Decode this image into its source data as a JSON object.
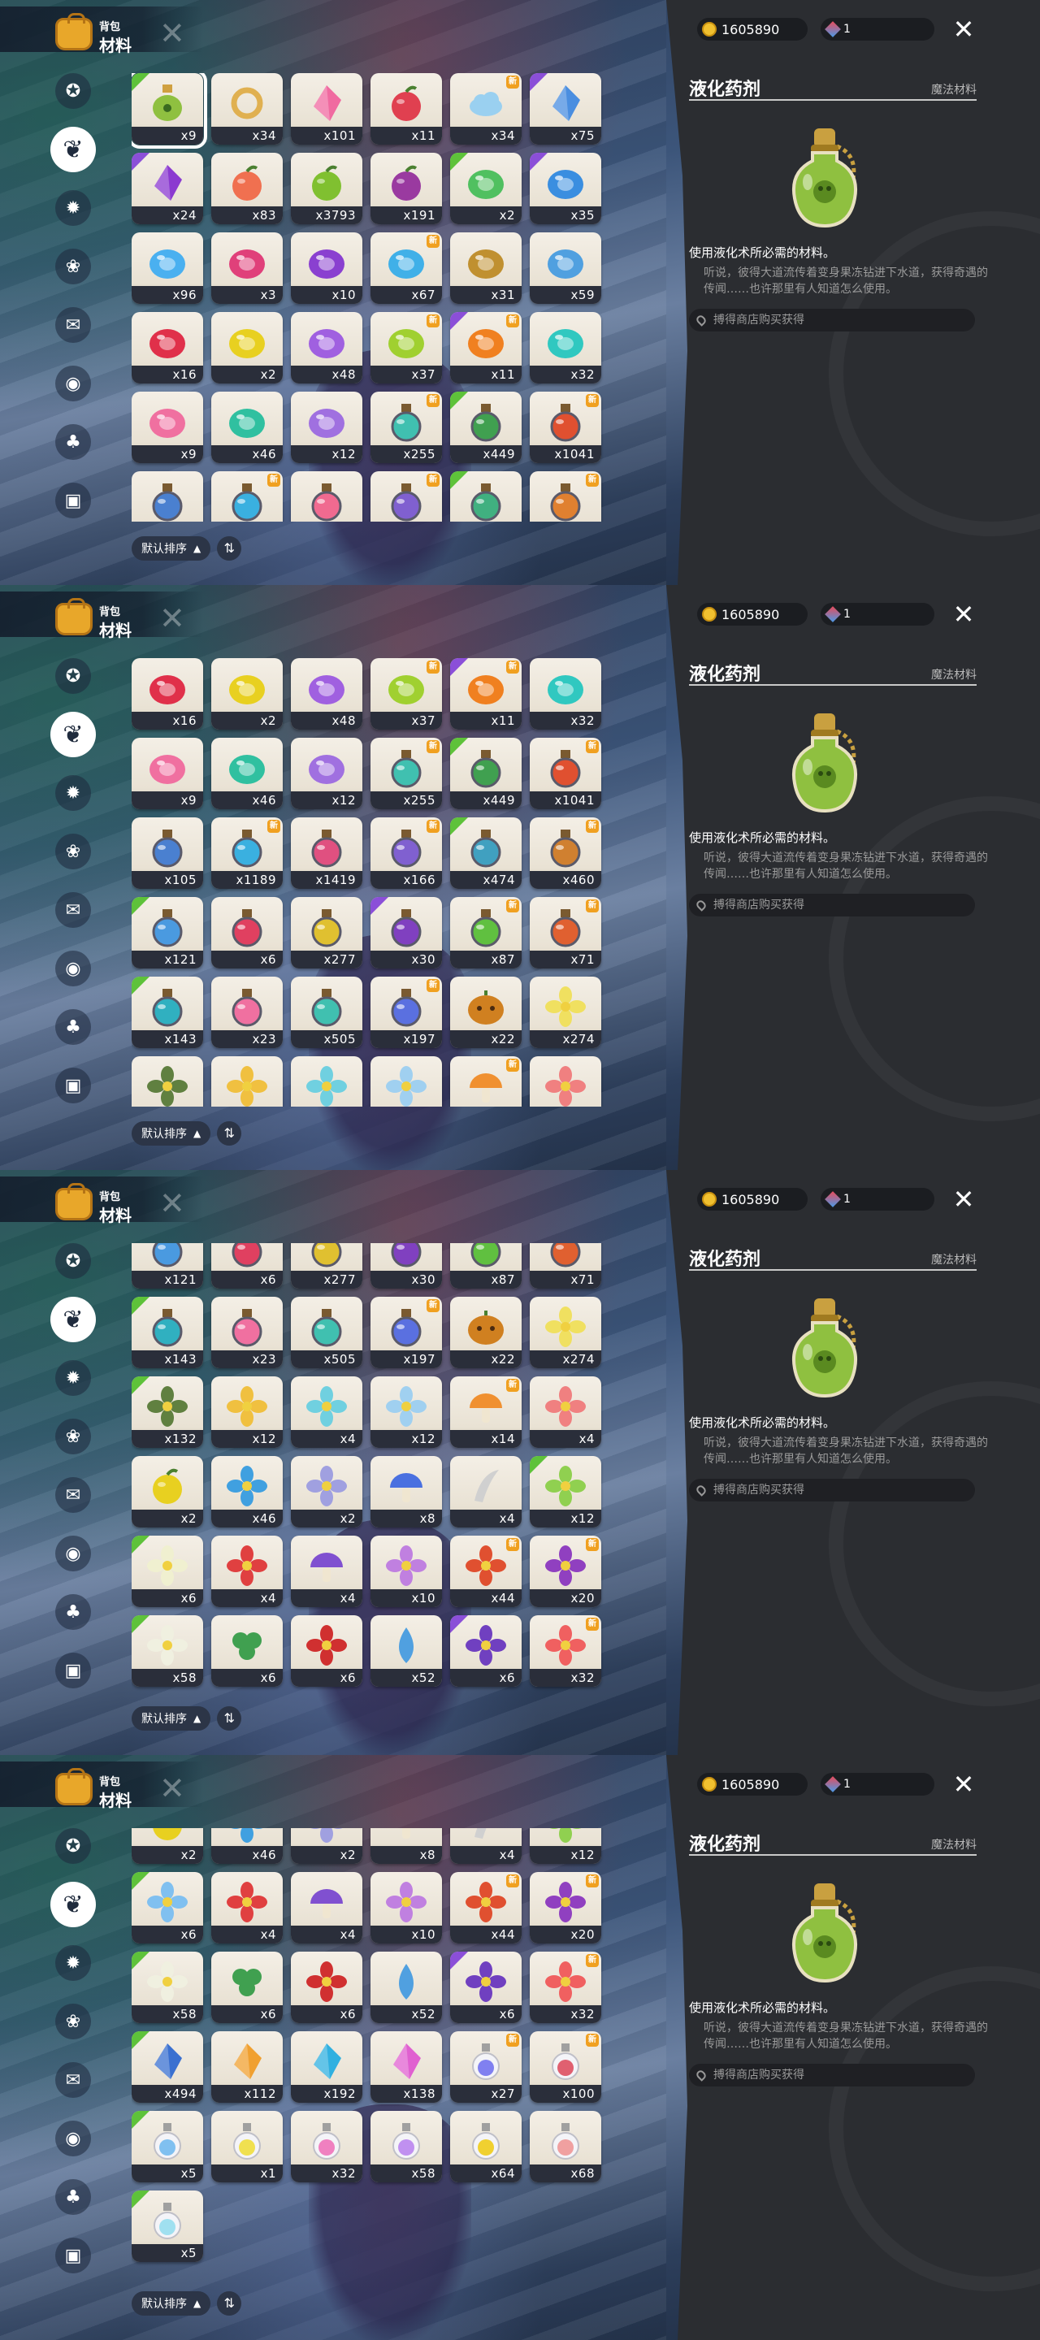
{
  "header": {
    "bag_label": "背包",
    "category_label": "材料"
  },
  "currency": {
    "coins": "1605890",
    "gems": "1"
  },
  "detail": {
    "title": "液化药剂",
    "type": "魔法材料",
    "summary": "使用液化术所必需的材料。",
    "description": "听说，彼得大道流传着变身果冻钻进下水道，获得奇遇的传闻……也许那里有人知道怎么使用。",
    "source": "搏得商店购买获得"
  },
  "sort": {
    "label": "默认排序"
  },
  "sidebar": {
    "icons": [
      "star-icon",
      "leaf-icon",
      "gear-icon",
      "petal-icon",
      "scroll-icon",
      "ball-icon",
      "bell-icon",
      "chest-icon"
    ],
    "selected": 1
  },
  "screens": [
    {
      "offset": 0,
      "rows": [
        [
          {
            "q": "x9",
            "c": "#8fc040",
            "s": "flask",
            "b": "green",
            "sel": true
          },
          {
            "q": "x34",
            "c": "#e0b050",
            "s": "ring"
          },
          {
            "q": "x101",
            "c": "#f06aa0",
            "s": "crystal"
          },
          {
            "q": "x11",
            "c": "#e04050",
            "s": "fruit"
          },
          {
            "q": "x34",
            "c": "#9ad0f0",
            "s": "cloud",
            "n": true
          },
          {
            "q": "x75",
            "c": "#4a8ee0",
            "s": "crystal",
            "b": "purple"
          }
        ],
        [
          {
            "q": "x24",
            "c": "#8b3ad0",
            "s": "crystal",
            "b": "purple"
          },
          {
            "q": "x83",
            "c": "#f07050",
            "s": "fruit"
          },
          {
            "q": "x3793",
            "c": "#80c030",
            "s": "fruit"
          },
          {
            "q": "x191",
            "c": "#9a3aa0",
            "s": "fruit"
          },
          {
            "q": "x2",
            "c": "#50c060",
            "s": "gem",
            "b": "green"
          },
          {
            "q": "x35",
            "c": "#3a8ee0",
            "s": "gem",
            "b": "purple"
          }
        ],
        [
          {
            "q": "x96",
            "c": "#4ab0f0",
            "s": "gem"
          },
          {
            "q": "x3",
            "c": "#e0407a",
            "s": "gem"
          },
          {
            "q": "x10",
            "c": "#8a40d0",
            "s": "gem"
          },
          {
            "q": "x67",
            "c": "#40b0e8",
            "s": "gem",
            "n": true
          },
          {
            "q": "x31",
            "c": "#c09030",
            "s": "gem"
          },
          {
            "q": "x59",
            "c": "#50a0e0",
            "s": "gem"
          }
        ],
        [
          {
            "q": "x16",
            "c": "#e0304a",
            "s": "gem"
          },
          {
            "q": "x2",
            "c": "#e8d020",
            "s": "gem"
          },
          {
            "q": "x48",
            "c": "#a060e0",
            "s": "gem"
          },
          {
            "q": "x37",
            "c": "#a0d030",
            "s": "gem",
            "n": true
          },
          {
            "q": "x11",
            "c": "#f08020",
            "s": "gem",
            "b": "purple",
            "n": true
          },
          {
            "q": "x32",
            "c": "#30c8c0",
            "s": "gem"
          }
        ],
        [
          {
            "q": "x9",
            "c": "#f070a0",
            "s": "gem"
          },
          {
            "q": "x46",
            "c": "#30c0a0",
            "s": "gem"
          },
          {
            "q": "x12",
            "c": "#a070e0",
            "s": "gem"
          },
          {
            "q": "x255",
            "c": "#40c0b0",
            "s": "potion",
            "n": true
          },
          {
            "q": "x449",
            "c": "#40a050",
            "s": "potion",
            "b": "green"
          },
          {
            "q": "x1041",
            "c": "#e05030",
            "s": "potion",
            "n": true
          }
        ],
        [
          {
            "q": "",
            "c": "#4a80d0",
            "s": "potion"
          },
          {
            "q": "",
            "c": "#3ab0e0",
            "s": "potion",
            "n": true
          },
          {
            "q": "",
            "c": "#f06a90",
            "s": "potion"
          },
          {
            "q": "",
            "c": "#8060d0",
            "s": "potion",
            "n": true
          },
          {
            "q": "",
            "c": "#40b080",
            "s": "potion",
            "b": "green"
          },
          {
            "q": "",
            "c": "#e08030",
            "s": "potion",
            "n": true
          }
        ]
      ]
    },
    {
      "offset": 0,
      "rows": [
        [
          {
            "q": "x16",
            "c": "#e0304a",
            "s": "gem"
          },
          {
            "q": "x2",
            "c": "#e8d020",
            "s": "gem"
          },
          {
            "q": "x48",
            "c": "#a060e0",
            "s": "gem"
          },
          {
            "q": "x37",
            "c": "#a0d030",
            "s": "gem",
            "n": true
          },
          {
            "q": "x11",
            "c": "#f08020",
            "s": "gem",
            "b": "purple",
            "n": true
          },
          {
            "q": "x32",
            "c": "#30c8c0",
            "s": "gem"
          }
        ],
        [
          {
            "q": "x9",
            "c": "#f070a0",
            "s": "gem"
          },
          {
            "q": "x46",
            "c": "#30c0a0",
            "s": "gem"
          },
          {
            "q": "x12",
            "c": "#a070e0",
            "s": "gem"
          },
          {
            "q": "x255",
            "c": "#40c0b0",
            "s": "potion",
            "n": true
          },
          {
            "q": "x449",
            "c": "#40a050",
            "s": "potion",
            "b": "green"
          },
          {
            "q": "x1041",
            "c": "#e05030",
            "s": "potion",
            "n": true
          }
        ],
        [
          {
            "q": "x105",
            "c": "#4a80d0",
            "s": "potion"
          },
          {
            "q": "x1189",
            "c": "#3ab0e0",
            "s": "potion",
            "n": true
          },
          {
            "q": "x1419",
            "c": "#e05080",
            "s": "potion"
          },
          {
            "q": "x166",
            "c": "#8060d0",
            "s": "potion",
            "n": true
          },
          {
            "q": "x474",
            "c": "#40a0c0",
            "s": "potion",
            "b": "green"
          },
          {
            "q": "x460",
            "c": "#d08030",
            "s": "potion",
            "n": true
          }
        ],
        [
          {
            "q": "x121",
            "c": "#4a9ae0",
            "s": "potion",
            "b": "green"
          },
          {
            "q": "x6",
            "c": "#e04060",
            "s": "potion"
          },
          {
            "q": "x277",
            "c": "#e0c030",
            "s": "potion"
          },
          {
            "q": "x30",
            "c": "#8040c0",
            "s": "potion",
            "b": "purple"
          },
          {
            "q": "x87",
            "c": "#60c040",
            "s": "potion",
            "n": true
          },
          {
            "q": "x71",
            "c": "#e06030",
            "s": "potion",
            "n": true
          }
        ],
        [
          {
            "q": "x143",
            "c": "#30b0c0",
            "s": "potion",
            "b": "green"
          },
          {
            "q": "x23",
            "c": "#f070a0",
            "s": "potion"
          },
          {
            "q": "x505",
            "c": "#40c0b0",
            "s": "potion"
          },
          {
            "q": "x197",
            "c": "#5a70e0",
            "s": "potion",
            "n": true
          },
          {
            "q": "x22",
            "c": "#d08020",
            "s": "pumpkin"
          },
          {
            "q": "x274",
            "c": "#f0e060",
            "s": "flower"
          }
        ],
        [
          {
            "q": "",
            "c": "#608040",
            "s": "flower"
          },
          {
            "q": "",
            "c": "#f0c040",
            "s": "flower"
          },
          {
            "q": "",
            "c": "#70d0e0",
            "s": "flower"
          },
          {
            "q": "",
            "c": "#a0d0f0",
            "s": "flower"
          },
          {
            "q": "",
            "c": "#f09030",
            "s": "mushroom",
            "n": true
          },
          {
            "q": "",
            "c": "#f08080",
            "s": "flower"
          }
        ]
      ]
    },
    {
      "offset": -32,
      "rows": [
        [
          {
            "q": "x121",
            "c": "#4a9ae0",
            "s": "potion",
            "b": "green"
          },
          {
            "q": "x6",
            "c": "#e04060",
            "s": "potion"
          },
          {
            "q": "x277",
            "c": "#e0c030",
            "s": "potion"
          },
          {
            "q": "x30",
            "c": "#8040c0",
            "s": "potion",
            "b": "purple"
          },
          {
            "q": "x87",
            "c": "#60c040",
            "s": "potion",
            "n": true
          },
          {
            "q": "x71",
            "c": "#e06030",
            "s": "potion",
            "n": true
          }
        ],
        [
          {
            "q": "x143",
            "c": "#30b0c0",
            "s": "potion",
            "b": "green"
          },
          {
            "q": "x23",
            "c": "#f070a0",
            "s": "potion"
          },
          {
            "q": "x505",
            "c": "#40c0b0",
            "s": "potion"
          },
          {
            "q": "x197",
            "c": "#5a70e0",
            "s": "potion",
            "n": true
          },
          {
            "q": "x22",
            "c": "#d08020",
            "s": "pumpkin"
          },
          {
            "q": "x274",
            "c": "#f0e060",
            "s": "flower"
          }
        ],
        [
          {
            "q": "x132",
            "c": "#608040",
            "s": "flower",
            "b": "green"
          },
          {
            "q": "x12",
            "c": "#f0c040",
            "s": "flower"
          },
          {
            "q": "x4",
            "c": "#70d0e0",
            "s": "flower"
          },
          {
            "q": "x12",
            "c": "#a0d0f0",
            "s": "flower"
          },
          {
            "q": "x14",
            "c": "#f09030",
            "s": "mushroom",
            "n": true
          },
          {
            "q": "x4",
            "c": "#f08080",
            "s": "flower"
          }
        ],
        [
          {
            "q": "x2",
            "c": "#e8d020",
            "s": "fruit"
          },
          {
            "q": "x46",
            "c": "#40a0e0",
            "s": "flower"
          },
          {
            "q": "x2",
            "c": "#a0a0e0",
            "s": "flower"
          },
          {
            "q": "x8",
            "c": "#4a70e0",
            "s": "mushroom"
          },
          {
            "q": "x4",
            "c": "#d0d0d0",
            "s": "horn"
          },
          {
            "q": "x12",
            "c": "#90d050",
            "s": "flower",
            "b": "green"
          }
        ],
        [
          {
            "q": "x6",
            "c": "#f0f0d0",
            "s": "flower",
            "b": "green"
          },
          {
            "q": "x4",
            "c": "#e04040",
            "s": "flower"
          },
          {
            "q": "x4",
            "c": "#8050d0",
            "s": "mushroom"
          },
          {
            "q": "x10",
            "c": "#c080e0",
            "s": "flower"
          },
          {
            "q": "x44",
            "c": "#e05030",
            "s": "flower",
            "n": true
          },
          {
            "q": "x20",
            "c": "#9040c0",
            "s": "flower",
            "n": true
          }
        ],
        [
          {
            "q": "x58",
            "c": "#f0f0e0",
            "s": "flower",
            "b": "green"
          },
          {
            "q": "x6",
            "c": "#40a050",
            "s": "leaf"
          },
          {
            "q": "x6",
            "c": "#d03030",
            "s": "flower"
          },
          {
            "q": "x52",
            "c": "#50a0e0",
            "s": "drop"
          },
          {
            "q": "x6",
            "c": "#7040c0",
            "s": "flower",
            "b": "purple"
          },
          {
            "q": "x32",
            "c": "#f06060",
            "s": "flower",
            "n": true
          }
        ]
      ]
    },
    {
      "offset": -44,
      "rows": [
        [
          {
            "q": "x2",
            "c": "#e8d020",
            "s": "fruit"
          },
          {
            "q": "x46",
            "c": "#40a0e0",
            "s": "flower"
          },
          {
            "q": "x2",
            "c": "#a0a0e0",
            "s": "flower"
          },
          {
            "q": "x8",
            "c": "#4a70e0",
            "s": "mushroom"
          },
          {
            "q": "x4",
            "c": "#d0d0d0",
            "s": "horn"
          },
          {
            "q": "x12",
            "c": "#90d050",
            "s": "flower",
            "b": "green"
          }
        ],
        [
          {
            "q": "x6",
            "c": "#80c0f0",
            "s": "flower",
            "b": "green"
          },
          {
            "q": "x4",
            "c": "#e04040",
            "s": "flower"
          },
          {
            "q": "x4",
            "c": "#8050d0",
            "s": "mushroom"
          },
          {
            "q": "x10",
            "c": "#c080e0",
            "s": "flower"
          },
          {
            "q": "x44",
            "c": "#e05030",
            "s": "flower",
            "n": true
          },
          {
            "q": "x20",
            "c": "#9040c0",
            "s": "flower",
            "n": true
          }
        ],
        [
          {
            "q": "x58",
            "c": "#f0f0e0",
            "s": "flower",
            "b": "green"
          },
          {
            "q": "x6",
            "c": "#40a050",
            "s": "leaf"
          },
          {
            "q": "x6",
            "c": "#d03030",
            "s": "flower"
          },
          {
            "q": "x52",
            "c": "#50a0e0",
            "s": "drop"
          },
          {
            "q": "x6",
            "c": "#7040c0",
            "s": "flower",
            "b": "purple"
          },
          {
            "q": "x32",
            "c": "#f06060",
            "s": "flower",
            "n": true
          }
        ],
        [
          {
            "q": "x494",
            "c": "#3a70d0",
            "s": "crystal",
            "b": "green"
          },
          {
            "q": "x112",
            "c": "#f0a030",
            "s": "crystal"
          },
          {
            "q": "x192",
            "c": "#30b0e0",
            "s": "crystal"
          },
          {
            "q": "x138",
            "c": "#e060d0",
            "s": "crystal"
          },
          {
            "q": "x27",
            "c": "#8080f0",
            "s": "bottle",
            "n": true
          },
          {
            "q": "x100",
            "c": "#e06070",
            "s": "bottle",
            "n": true
          }
        ],
        [
          {
            "q": "x5",
            "c": "#80c0f0",
            "s": "bottle",
            "b": "green"
          },
          {
            "q": "x1",
            "c": "#f0e050",
            "s": "bottle"
          },
          {
            "q": "x32",
            "c": "#f080c0",
            "s": "bottle"
          },
          {
            "q": "x58",
            "c": "#c090f0",
            "s": "bottle"
          },
          {
            "q": "x64",
            "c": "#f0d030",
            "s": "bottle"
          },
          {
            "q": "x68",
            "c": "#f0a0a0",
            "s": "bottle"
          }
        ],
        [
          {
            "q": "x5",
            "c": "#a0e0f0",
            "s": "bottle",
            "b": "green"
          }
        ]
      ]
    }
  ]
}
